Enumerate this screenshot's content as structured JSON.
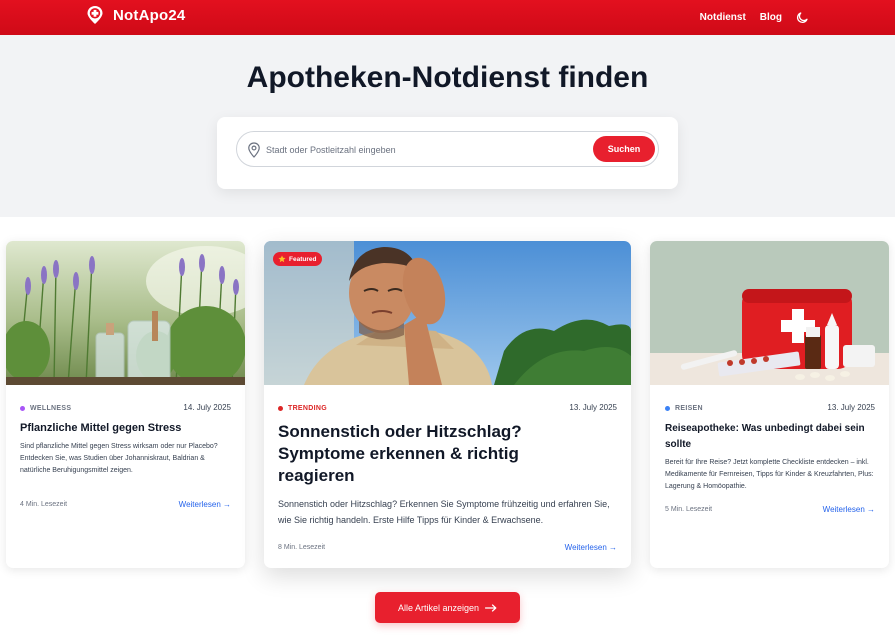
{
  "header": {
    "brand": "NotApo24",
    "nav": [
      "Notdienst",
      "Blog"
    ],
    "icons": {
      "logo": "pharmacy-cross-pin-icon",
      "theme": "moon-icon"
    }
  },
  "hero": {
    "title": "Apotheken-Notdienst finden",
    "search": {
      "placeholder": "Stadt oder Postleitzahl eingeben",
      "value": "",
      "button": "Suchen",
      "icon": "map-pin-icon"
    }
  },
  "articles": [
    {
      "category": "WELLNESS",
      "category_color": "#a855f7",
      "date": "14. July 2025",
      "title": "Pflanzliche Mittel gegen Stress",
      "excerpt": "Sind pflanzliche Mittel gegen Stress wirksam oder nur Placebo? Entdecken Sie, was Studien über Johanniskraut, Baldrian & natürliche Beruhigungsmittel zeigen.",
      "read_time": "4 Min. Lesezeit",
      "link": "Weiterlesen →",
      "image": "herbs-lavender-jars-photo"
    },
    {
      "badge": "Featured",
      "badge_icon": "star-icon",
      "category": "TRENDING",
      "category_color": "#dc2626",
      "date": "13. July 2025",
      "title": "Sonnenstich oder Hitzschlag? Symptome erkennen & richtig reagieren",
      "excerpt": "Sonnenstich oder Hitzschlag? Erkennen Sie Symptome frühzeitig und erfahren Sie, wie Sie richtig handeln. Erste Hilfe Tipps für Kinder & Erwachsene.",
      "read_time": "8 Min. Lesezeit",
      "link": "Weiterlesen →",
      "image": "man-headache-sun-photo"
    },
    {
      "category": "REISEN",
      "category_color": "#3b82f6",
      "date": "13. July 2025",
      "title": "Reiseapotheke: Was unbedingt dabei sein sollte",
      "excerpt": "Bereit für Ihre Reise? Jetzt komplette Checkliste entdecken – inkl. Medikamente für Fernreisen, Tipps für Kinder & Kreuzfahrten, Plus: Lagerung & Homöopathie.",
      "read_time": "5 Min. Lesezeit",
      "link": "Weiterlesen →",
      "image": "first-aid-kit-pills-photo"
    }
  ],
  "footer_button": {
    "label": "Alle Artikel anzeigen",
    "icon": "arrow-right-icon"
  },
  "colors": {
    "primary": "#e8202e",
    "link": "#2563eb",
    "hero_bg": "#f2f3f5"
  }
}
